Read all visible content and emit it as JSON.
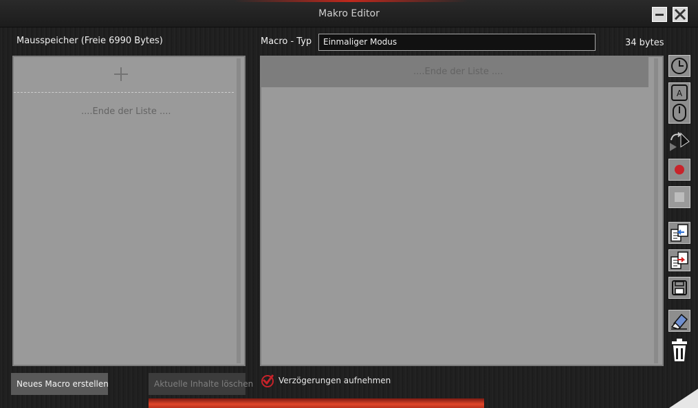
{
  "window": {
    "title": "Makro Editor"
  },
  "left": {
    "heading": "Mausspeicher (Freie 6990 Bytes)",
    "list_end": "....Ende der Liste ...."
  },
  "right": {
    "macro_type_label": "Macro - Typ",
    "macro_type_value": "Einmaliger Modus",
    "bytes": "34 bytes",
    "list_end": "....Ende der Liste ...."
  },
  "footer": {
    "new_macro": "Neues Macro erstellen",
    "clear_content": "Aktuelle Inhalte löschen",
    "record_delays": "Verzögerungen aufnehmen",
    "record_delays_checked": true
  },
  "toolbar_icons": [
    "delay-clock-icon",
    "keyboard-mouse-event-icon",
    "loop-cursor-icon",
    "record-icon",
    "stop-icon",
    "import-icon",
    "export-icon",
    "save-icon",
    "eraser-icon",
    "trash-icon"
  ],
  "colors": {
    "accent_red": "#c8232a",
    "panel_gray": "#9a9a9a",
    "header_row_gray": "#7d7d7d"
  }
}
